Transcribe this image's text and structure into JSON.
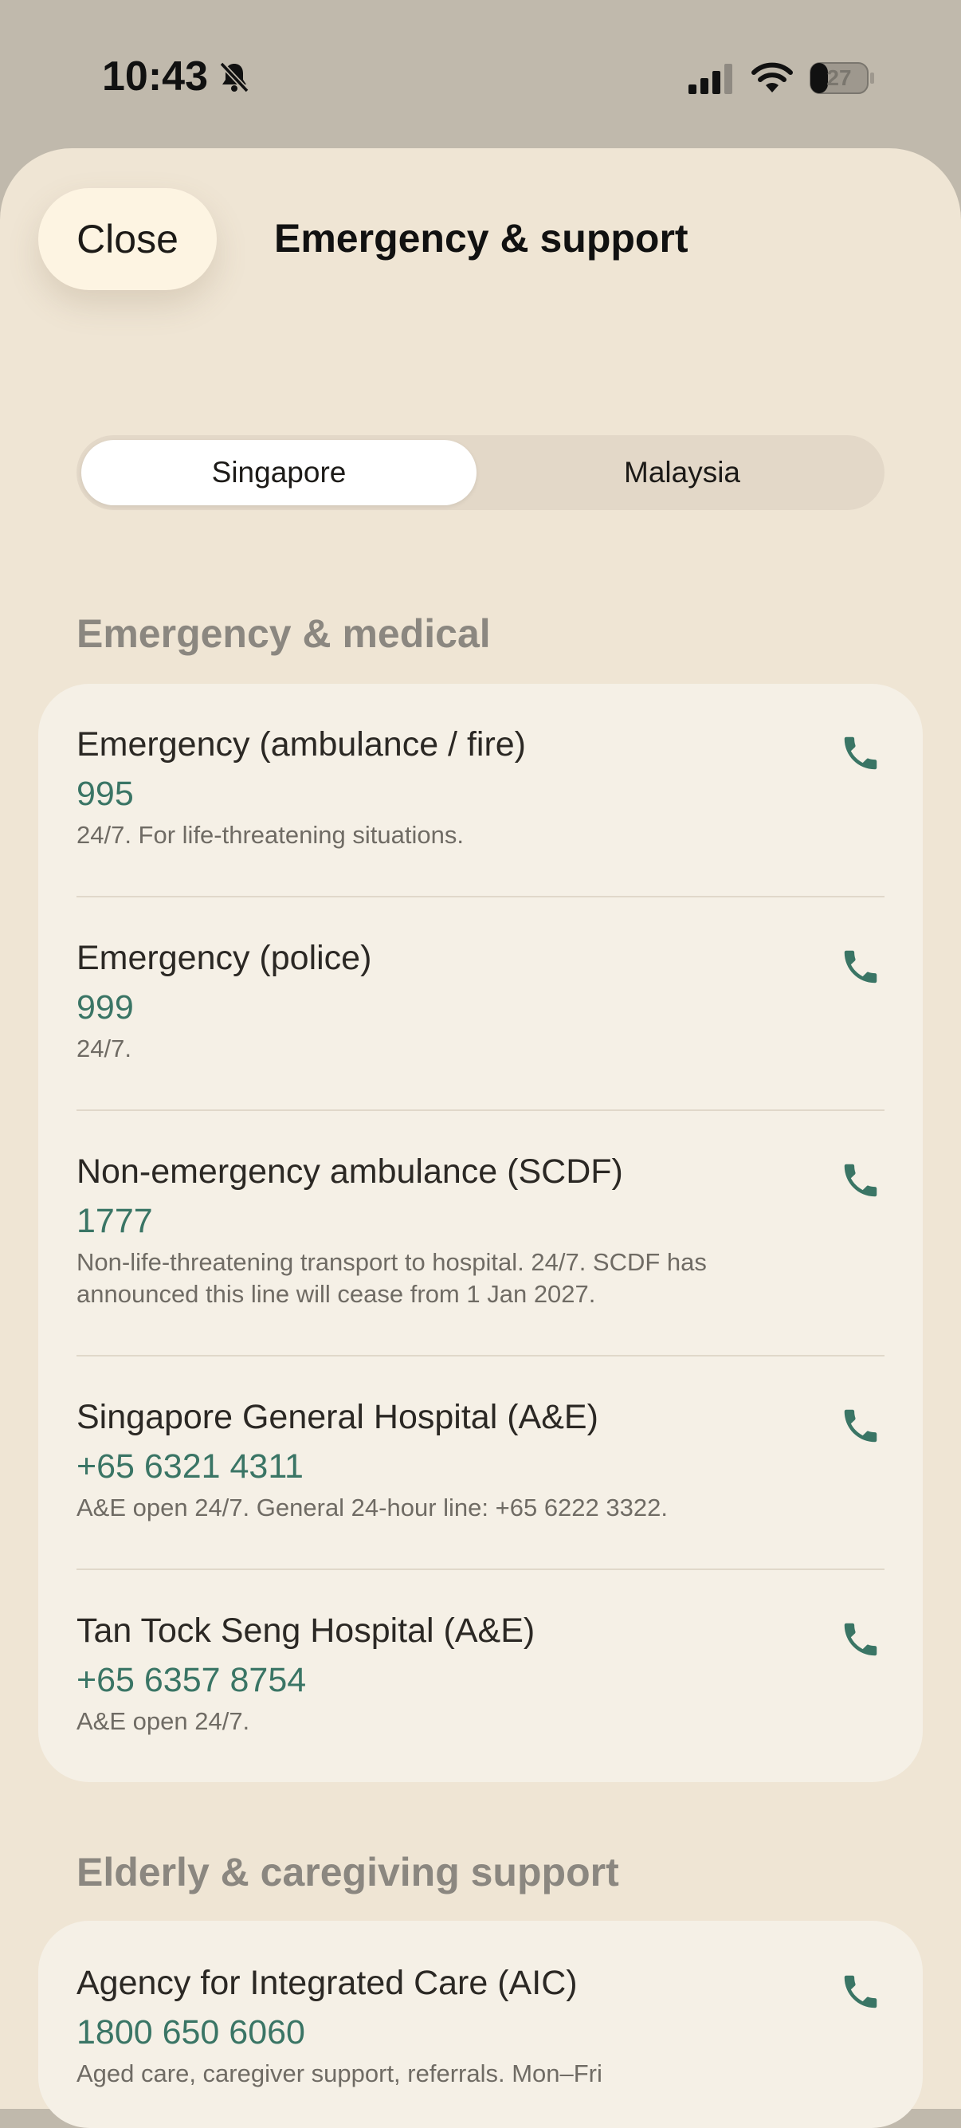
{
  "status_bar": {
    "time": "10:43",
    "battery": "27",
    "icons": [
      "bell-slash-icon",
      "cellular-signal-icon",
      "wifi-icon",
      "battery-icon"
    ]
  },
  "header": {
    "close_label": "Close",
    "title": "Emergency & support"
  },
  "segments": {
    "options": [
      "Singapore",
      "Malaysia"
    ],
    "selected": "Singapore"
  },
  "sections": [
    {
      "title": "Emergency & medical",
      "entries": [
        {
          "name": "Emergency (ambulance / fire)",
          "phone": "995",
          "note": "24/7. For life-threatening situations."
        },
        {
          "name": "Emergency (police)",
          "phone": "999",
          "note": "24/7."
        },
        {
          "name": "Non-emergency ambulance (SCDF)",
          "phone": "1777",
          "note": "Non-life-threatening transport to hospital. 24/7. SCDF has announced this line will cease from 1 Jan 2027."
        },
        {
          "name": "Singapore General Hospital (A&E)",
          "phone": "+65 6321 4311",
          "note": "A&E open 24/7. General 24-hour line: +65 6222 3322."
        },
        {
          "name": "Tan Tock Seng Hospital (A&E)",
          "phone": "+65 6357 8754",
          "note": "A&E open 24/7."
        }
      ]
    },
    {
      "title": "Elderly & caregiving support",
      "entries": [
        {
          "name": "Agency for Integrated Care (AIC)",
          "phone": "1800 650 6060",
          "note": "Aged care, caregiver support, referrals. Mon–Fri"
        }
      ]
    }
  ],
  "colors": {
    "accent": "#3a7565",
    "sheet_bg": "#efe5d4",
    "card_bg": "#f5f0e6",
    "section_title": "#8b8780"
  }
}
